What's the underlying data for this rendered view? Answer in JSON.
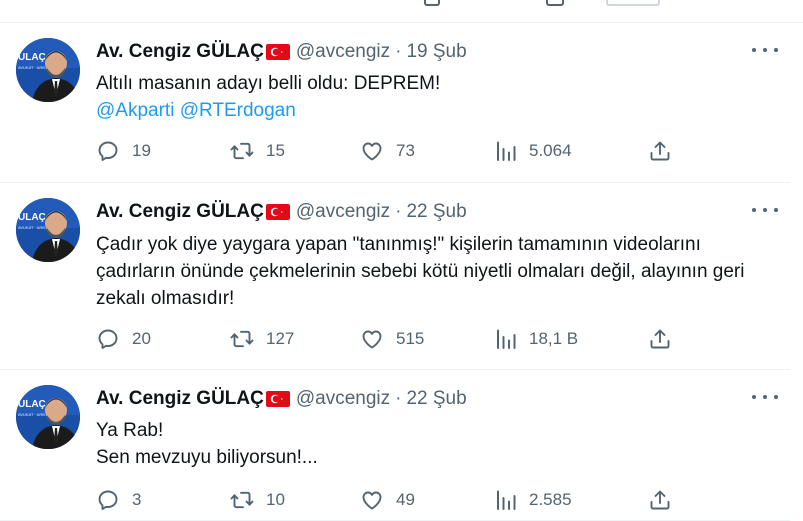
{
  "tweets": [
    {
      "name": "Av. Cengiz GÜLAÇ",
      "handle": "@avcengiz",
      "separator": "·",
      "time": "19 Şub",
      "lines": [
        "Altılı masanın adayı belli oldu: DEPREM!"
      ],
      "mentions": [
        "@Akparti",
        "@RTErdogan"
      ],
      "stats": {
        "replies": "19",
        "retweets": "15",
        "likes": "73",
        "views": "5.064"
      }
    },
    {
      "name": "Av. Cengiz GÜLAÇ",
      "handle": "@avcengiz",
      "separator": "·",
      "time": "22 Şub",
      "lines": [
        "Çadır yok diye yaygara yapan \"tanınmış!\" kişilerin tamamının videolarını",
        "çadırların önünde çekmelerinin sebebi kötü niyetli olmaları değil, alayının geri",
        "zekalı olmasıdır!"
      ],
      "stats": {
        "replies": "20",
        "retweets": "127",
        "likes": "515",
        "views": "18,1 B"
      }
    },
    {
      "name": "Av. Cengiz GÜLAÇ",
      "handle": "@avcengiz",
      "separator": "·",
      "time": "22 Şub",
      "lines": [
        "Ya Rab!",
        "Sen mevzuyu biliyorsun!..."
      ],
      "stats": {
        "replies": "3",
        "retweets": "10",
        "likes": "49",
        "views": "2.585"
      }
    }
  ],
  "colors": {
    "text": "#0f1419",
    "secondary": "#536471",
    "link": "#1d9bf0",
    "divider": "#eff3f4",
    "flag_red": "#e30a17"
  }
}
